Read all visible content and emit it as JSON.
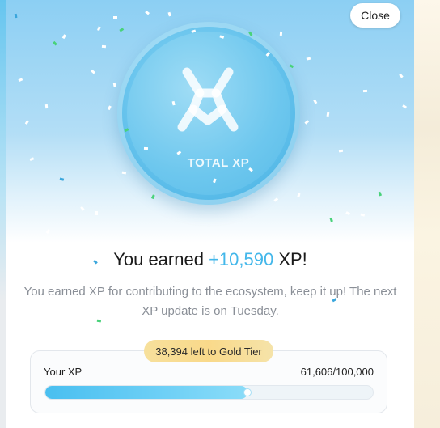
{
  "modal": {
    "close_label": "Close",
    "coin_label": "TOTAL XP",
    "headline_prefix": "You earned ",
    "headline_amount": "+10,590",
    "headline_suffix": " XP!",
    "description": "You earned XP for contributing to the ecosystem, keep it up! The next XP update is on Tuesday.",
    "tier_badge": "38,394 left to Gold Tier",
    "xp_label": "Your XP",
    "xp_value": "61,606/100,000",
    "xp_progress": 0.61606
  },
  "colors": {
    "accent": "#43b7ea",
    "coin": "#6cc6ee",
    "tier_gold": "#f9d98a",
    "confetti_green": "#49d27a",
    "confetti_blue": "#3aa6dc"
  },
  "icons": {
    "coin_logo": "xp-logo-icon",
    "close": "close-button"
  }
}
